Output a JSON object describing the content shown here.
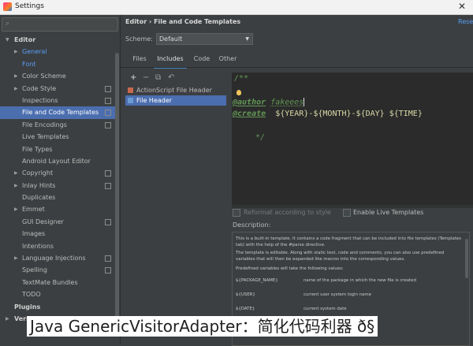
{
  "window": {
    "title": "Settings",
    "close_glyph": "✕"
  },
  "sidebar": {
    "search_placeholder": "",
    "items": [
      {
        "label": "Editor",
        "level": 0,
        "arrow": "▼"
      },
      {
        "label": "General",
        "level": 1,
        "arrow": "▶",
        "link": true
      },
      {
        "label": "Font",
        "level": 1,
        "arrow": "",
        "link": true
      },
      {
        "label": "Color Scheme",
        "level": 1,
        "arrow": "▶"
      },
      {
        "label": "Code Style",
        "level": 1,
        "arrow": "▶",
        "cfg": true
      },
      {
        "label": "Inspections",
        "level": 1,
        "arrow": "",
        "cfg": true
      },
      {
        "label": "File and Code Templates",
        "level": 1,
        "arrow": "",
        "cfg": true,
        "selected": true
      },
      {
        "label": "File Encodings",
        "level": 1,
        "arrow": "",
        "cfg": true
      },
      {
        "label": "Live Templates",
        "level": 1,
        "arrow": ""
      },
      {
        "label": "File Types",
        "level": 1,
        "arrow": ""
      },
      {
        "label": "Android Layout Editor",
        "level": 1,
        "arrow": ""
      },
      {
        "label": "Copyright",
        "level": 1,
        "arrow": "▶",
        "cfg": true
      },
      {
        "label": "Inlay Hints",
        "level": 1,
        "arrow": "▶",
        "cfg": true
      },
      {
        "label": "Duplicates",
        "level": 1,
        "arrow": ""
      },
      {
        "label": "Emmet",
        "level": 1,
        "arrow": "▶"
      },
      {
        "label": "GUI Designer",
        "level": 1,
        "arrow": "",
        "cfg": true
      },
      {
        "label": "Images",
        "level": 1,
        "arrow": ""
      },
      {
        "label": "Intentions",
        "level": 1,
        "arrow": ""
      },
      {
        "label": "Language Injections",
        "level": 1,
        "arrow": "▶",
        "cfg": true
      },
      {
        "label": "Spelling",
        "level": 1,
        "arrow": "",
        "cfg": true
      },
      {
        "label": "TextMate Bundles",
        "level": 1,
        "arrow": ""
      },
      {
        "label": "TODO",
        "level": 1,
        "arrow": ""
      },
      {
        "label": "Plugins",
        "level": 0,
        "arrow": ""
      },
      {
        "label": "Version Control",
        "level": 0,
        "arrow": "▶"
      }
    ]
  },
  "header": {
    "breadcrumb": "Editor  ›  File and Code Templates",
    "reset_label": "Reset"
  },
  "scheme": {
    "label": "Scheme:",
    "value": "Default"
  },
  "tabs": [
    {
      "label": "Files"
    },
    {
      "label": "Includes",
      "active": true
    },
    {
      "label": "Code"
    },
    {
      "label": "Other"
    }
  ],
  "toolbar": {
    "add": "+",
    "remove": "−",
    "copy": "⧉",
    "revert": "↶"
  },
  "templates": [
    {
      "label": "ActionScript File Header",
      "icon_color": "#c8694e"
    },
    {
      "label": "File Header",
      "icon_color": "#6b9bd2",
      "selected": true
    }
  ],
  "editor": {
    "line1": "/**",
    "author_tag": "@author",
    "author_value": "fakeees",
    "create_tag": "@create",
    "create_value": "${YEAR}-${MONTH}-${DAY} ${TIME}",
    "line_end": "*/"
  },
  "options": {
    "reformat": "Reformat according to style",
    "live_templates": "Enable Live Templates"
  },
  "description": {
    "label": "Description:",
    "para1": "This is a built-in template. It contains a code fragment that can be included into file templates (Templates tab) with the help of the #parse directive.",
    "para2": "The template is editable. Along with static text, code and comments, you can also use predefined variables that will then be expanded like macros into the corresponding values.",
    "para3": "Predefined variables will take the following values:",
    "vars": [
      {
        "name": "${PACKAGE_NAME}",
        "desc": "name of the package in which the new file is created"
      },
      {
        "name": "${USER}",
        "desc": "current user system login name"
      },
      {
        "name": "${DATE}",
        "desc": "current system date"
      }
    ]
  },
  "caption": "Java GenericVisitorAdapter：简化代码利器 ð§"
}
